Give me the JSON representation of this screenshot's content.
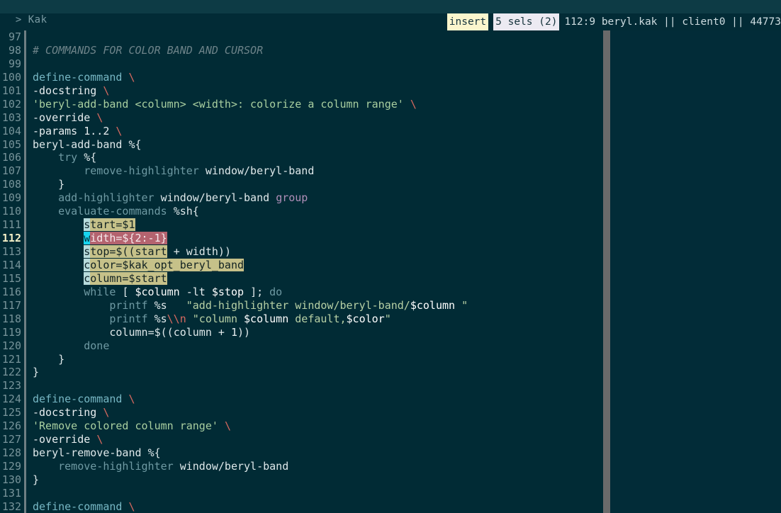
{
  "window": {
    "title": "> Kak",
    "prompt_glyph": ">",
    "name": "Kak"
  },
  "statusbar": {
    "mode": "insert",
    "selections": "5 sels (2)",
    "position": "112:9",
    "filename": "beryl.kak",
    "separator": "||",
    "client": "client0",
    "session": "44773",
    "rest": "112:9 beryl.kak || client0 || 44773",
    "colors": {
      "mode_bg": "#fbf6cd",
      "mode_fg": "#14333c",
      "sels_bg": "#eceaf2",
      "sels_fg": "#15323b",
      "rest_fg": "#cfdde1"
    }
  },
  "editor": {
    "first_line": 97,
    "cursor_line": 112,
    "cursor_column": 9,
    "column_marker": 80,
    "lines": [
      {
        "n": "97",
        "text": ""
      },
      {
        "n": "98",
        "text": "# COMMANDS FOR COLOR BAND AND CURSOR"
      },
      {
        "n": "99",
        "text": ""
      },
      {
        "n": "100",
        "text": "define-command \\"
      },
      {
        "n": "101",
        "text": "-docstring \\"
      },
      {
        "n": "102",
        "text": "'beryl-add-band <column> <width>: colorize a column range' \\"
      },
      {
        "n": "103",
        "text": "-override \\"
      },
      {
        "n": "104",
        "text": "-params 1..2 \\"
      },
      {
        "n": "105",
        "text": "beryl-add-band %{"
      },
      {
        "n": "106",
        "text": "    try %{"
      },
      {
        "n": "107",
        "text": "        remove-highlighter window/beryl-band"
      },
      {
        "n": "108",
        "text": "    }"
      },
      {
        "n": "109",
        "text": "    add-highlighter window/beryl-band group"
      },
      {
        "n": "110",
        "text": "    evaluate-commands %sh{"
      },
      {
        "n": "111",
        "text": "        start=$1"
      },
      {
        "n": "112",
        "text": "        width=${2:-1}"
      },
      {
        "n": "113",
        "text": "        stop=$((start + width))"
      },
      {
        "n": "114",
        "text": "        color=$kak_opt_beryl_band"
      },
      {
        "n": "115",
        "text": "        column=$start"
      },
      {
        "n": "116",
        "text": "        while [ $column -lt $stop ]; do"
      },
      {
        "n": "117",
        "text": "            printf %s   \"add-highlighter window/beryl-band/$column \""
      },
      {
        "n": "118",
        "text": "            printf %s\\\\n \"column $column default,$color\""
      },
      {
        "n": "119",
        "text": "            column=$((column + 1))"
      },
      {
        "n": "120",
        "text": "        done"
      },
      {
        "n": "121",
        "text": "    }"
      },
      {
        "n": "122",
        "text": "}"
      },
      {
        "n": "123",
        "text": ""
      },
      {
        "n": "124",
        "text": "define-command \\"
      },
      {
        "n": "125",
        "text": "-docstring \\"
      },
      {
        "n": "126",
        "text": "'Remove colored column range' \\"
      },
      {
        "n": "127",
        "text": "-override \\"
      },
      {
        "n": "128",
        "text": "beryl-remove-band %{"
      },
      {
        "n": "129",
        "text": "    remove-highlighter window/beryl-band"
      },
      {
        "n": "130",
        "text": "}"
      },
      {
        "n": "131",
        "text": ""
      },
      {
        "n": "132",
        "text": "define-command \\"
      }
    ],
    "selections": [
      {
        "line": "111",
        "text": "start=$1",
        "cursor": "s",
        "kind": "secondary"
      },
      {
        "line": "112",
        "text": "width=${2:-1}",
        "cursor": "w",
        "kind": "primary"
      },
      {
        "line": "113",
        "text": "stop=$((start",
        "cursor": "s",
        "kind": "secondary"
      },
      {
        "line": "114",
        "text": "color=$kak_opt_beryl_band",
        "cursor": "c",
        "kind": "secondary"
      },
      {
        "line": "115",
        "text": "column=$start",
        "cursor": "c",
        "kind": "secondary"
      }
    ],
    "colors": {
      "background": "#012b35",
      "gutter_fg": "#78949a",
      "current_line_fg": "#f5f0c8",
      "comment": "#6d8389",
      "command": "#77b7c4",
      "string": "#a9cfa0",
      "continuation": "#d7695f",
      "builtin": "#6f9aa3",
      "group": "#b08fb8",
      "plain": "#dfe8ea",
      "selection_secondary": "#c6c189",
      "selection_primary": "#b4636f",
      "cursor_secondary": "#b7dbdc",
      "cursor_primary": "#16d5f0",
      "column_marker": "#6a6a6a"
    }
  }
}
